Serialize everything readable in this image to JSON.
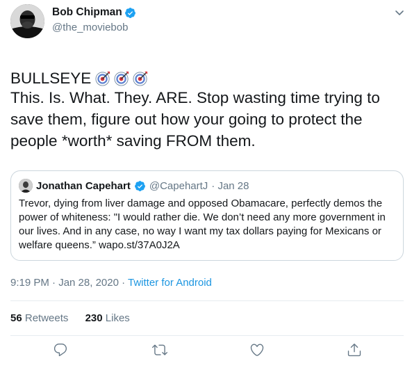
{
  "author": {
    "name": "Bob Chipman",
    "handle": "@the_moviebob",
    "verified": true
  },
  "tweet": {
    "line1": "BULLSEYE",
    "bullseye_count": 3,
    "line2": "This. Is. What. They. ARE. Stop wasting time trying to save them, figure out how your going to protect the people *worth* saving FROM them."
  },
  "quote": {
    "name": "Jonathan Capehart",
    "handle": "@CapehartJ",
    "date": "· Jan 28",
    "text": "Trevor, dying from liver damage and opposed Obamacare, perfectly demos the power of whiteness: \"I would rather die. We don’t need any more government in our lives. And in any case, no way I want my tax dollars paying for Mexicans or welfare queens.” wapo.st/37A0J2A"
  },
  "meta": {
    "time": "9:19 PM · Jan 28, 2020 ·",
    "source": "Twitter for Android"
  },
  "stats": {
    "retweets_count": "56",
    "retweets_label": "Retweets",
    "likes_count": "230",
    "likes_label": "Likes"
  },
  "icons": {
    "reply": "reply-icon",
    "retweet": "retweet-icon",
    "like": "like-icon",
    "share": "share-icon",
    "verified": "verified-badge-icon",
    "caret": "chevron-down-icon",
    "bullseye": "bullseye-emoji-icon"
  },
  "colors": {
    "text": "#14171a",
    "secondary": "#657786",
    "link": "#1b95e0",
    "verified": "#1da1f2",
    "border": "#ccd6dd"
  }
}
